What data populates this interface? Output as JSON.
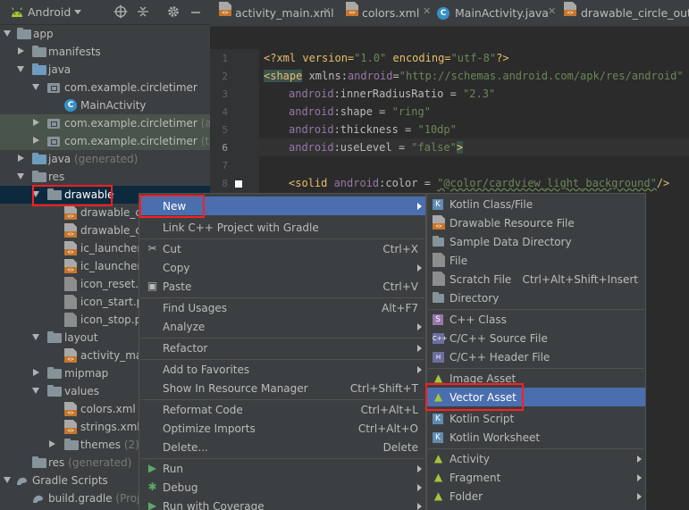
{
  "project_panel": {
    "title": "Android",
    "tree": [
      {
        "label": "app",
        "indent": 0
      },
      {
        "label": "manifests",
        "indent": 1
      },
      {
        "label": "java",
        "indent": 1
      },
      {
        "label": "com.example.circletimer",
        "indent": 2
      },
      {
        "label": "MainActivity",
        "indent": 3
      },
      {
        "label": "com.example.circletimer",
        "suffix": "(andr",
        "indent": 2
      },
      {
        "label": "com.example.circletimer",
        "suffix": "(test)",
        "indent": 2
      },
      {
        "label": "java",
        "suffix": "(generated)",
        "indent": 1
      },
      {
        "label": "res",
        "indent": 1
      },
      {
        "label": "drawable",
        "indent": 2
      },
      {
        "label": "drawable_cir",
        "indent": 3
      },
      {
        "label": "drawable_cir",
        "indent": 3
      },
      {
        "label": "ic_launcher_",
        "indent": 3
      },
      {
        "label": "ic_launcher_",
        "indent": 3
      },
      {
        "label": "icon_reset.pn",
        "indent": 3
      },
      {
        "label": "icon_start.pn",
        "indent": 3
      },
      {
        "label": "icon_stop.pn",
        "indent": 3
      },
      {
        "label": "layout",
        "indent": 2
      },
      {
        "label": "activity_main",
        "indent": 3
      },
      {
        "label": "mipmap",
        "indent": 2
      },
      {
        "label": "values",
        "indent": 2
      },
      {
        "label": "colors.xml",
        "indent": 3
      },
      {
        "label": "strings.xml",
        "indent": 3
      },
      {
        "label": "themes",
        "suffix": "(2)",
        "indent": 3
      },
      {
        "label": "res",
        "suffix": "(generated)",
        "indent": 1
      },
      {
        "label": "Gradle Scripts",
        "indent": 0
      },
      {
        "label": "build.gradle",
        "suffix": "(Proje",
        "indent": 1
      }
    ]
  },
  "editor": {
    "tabs": [
      "activity_main.xml",
      "colors.xml",
      "MainActivity.java",
      "drawable_circle_outer.x"
    ],
    "line_numbers": [
      "1",
      "2",
      "3",
      "4",
      "5",
      "6",
      "7",
      "8"
    ],
    "lines": {
      "l1_a": "<?xml version=",
      "l1_b": "\"1.0\"",
      "l1_c": " encoding=",
      "l1_d": "\"utf-8\"",
      "l1_e": "?>",
      "l2_tag": "<shape",
      "l2_attr": " xmlns:",
      "l2_ns": "android",
      "l2_eq": "=",
      "l2_str": "\"http://schemas.android.com/apk/res/android\"",
      "l3_ns": "android",
      "l3_attr": ":innerRadiusRatio = ",
      "l3_str": "\"2.3\"",
      "l4_ns": "android",
      "l4_attr": ":shape = ",
      "l4_str": "\"ring\"",
      "l5_ns": "android",
      "l5_attr": ":thickness = ",
      "l5_str": "\"10dp\"",
      "l6_ns": "android",
      "l6_attr": ":useLevel = ",
      "l6_str": "\"false\"",
      "l6_end": ">",
      "l8_tag": "<solid",
      "l8_ns": " android",
      "l8_attr": ":color = ",
      "l8_str": "\"@color/cardview_light_background\"",
      "l8_end": "/>"
    }
  },
  "context_menu": {
    "items": [
      {
        "label": "New",
        "shortcut": "",
        "submenu": true
      },
      {
        "label": "Link C++ Project with Gradle",
        "shortcut": ""
      },
      {
        "label": "Cut",
        "shortcut": "Ctrl+X",
        "icon": "scissors"
      },
      {
        "label": "Copy",
        "shortcut": "",
        "submenu": true
      },
      {
        "label": "Paste",
        "shortcut": "Ctrl+V",
        "icon": "clipboard"
      },
      {
        "label": "Find Usages",
        "shortcut": "Alt+F7"
      },
      {
        "label": "Analyze",
        "shortcut": "",
        "submenu": true
      },
      {
        "label": "Refactor",
        "shortcut": "",
        "submenu": true
      },
      {
        "label": "Add to Favorites",
        "shortcut": "",
        "submenu": true
      },
      {
        "label": "Show In Resource Manager",
        "shortcut": "Ctrl+Shift+T"
      },
      {
        "label": "Reformat Code",
        "shortcut": "Ctrl+Alt+L"
      },
      {
        "label": "Optimize Imports",
        "shortcut": "Ctrl+Alt+O"
      },
      {
        "label": "Delete...",
        "shortcut": "Delete"
      },
      {
        "label": "Run",
        "shortcut": "",
        "submenu": true,
        "icon": "run"
      },
      {
        "label": "Debug",
        "shortcut": "",
        "submenu": true,
        "icon": "debug"
      },
      {
        "label": "Run with Coverage",
        "shortcut": "",
        "submenu": true,
        "icon": "coverage"
      }
    ]
  },
  "new_submenu": {
    "items": [
      {
        "label": "Kotlin Class/File",
        "shortcut": ""
      },
      {
        "label": "Drawable Resource File",
        "shortcut": ""
      },
      {
        "label": "Sample Data Directory",
        "shortcut": ""
      },
      {
        "label": "File",
        "shortcut": ""
      },
      {
        "label": "Scratch File",
        "shortcut": "Ctrl+Alt+Shift+Insert"
      },
      {
        "label": "Directory",
        "shortcut": ""
      },
      {
        "label": "C++ Class",
        "shortcut": ""
      },
      {
        "label": "C/C++ Source File",
        "shortcut": ""
      },
      {
        "label": "C/C++ Header File",
        "shortcut": ""
      },
      {
        "label": "Image Asset",
        "shortcut": ""
      },
      {
        "label": "Vector Asset",
        "shortcut": ""
      },
      {
        "label": "Kotlin Script",
        "shortcut": ""
      },
      {
        "label": "Kotlin Worksheet",
        "shortcut": ""
      },
      {
        "label": "Activity",
        "shortcut": "",
        "submenu": true
      },
      {
        "label": "Fragment",
        "shortcut": "",
        "submenu": true
      },
      {
        "label": "Folder",
        "shortcut": "",
        "submenu": true
      }
    ]
  },
  "colors": {
    "highlight": "#4b6eaf",
    "annotation": "#ff1f1f",
    "android_green": "#a4c639"
  }
}
